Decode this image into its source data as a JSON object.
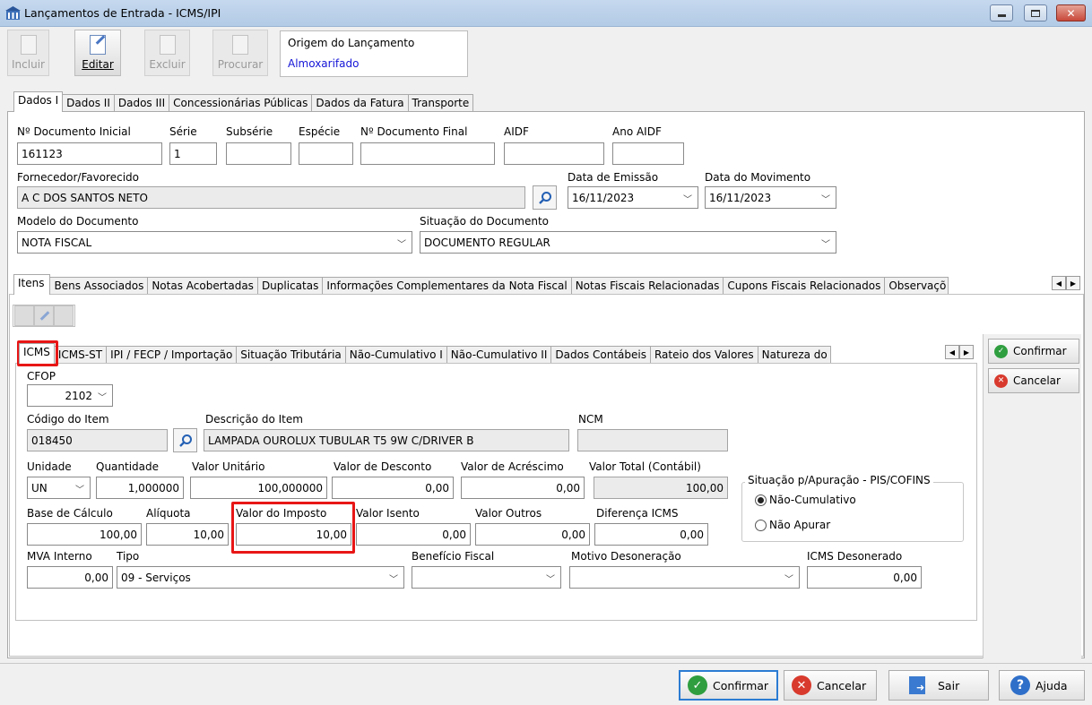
{
  "window": {
    "title": "Lançamentos de Entrada - ICMS/IPI"
  },
  "toolbar": {
    "incluir": "Incluir",
    "editar": "Editar",
    "excluir": "Excluir",
    "procurar": "Procurar"
  },
  "origem": {
    "label": "Origem do Lançamento",
    "value": "Almoxarifado"
  },
  "top_tabs": [
    "Dados I",
    "Dados II",
    "Dados III",
    "Concessionárias Públicas",
    "Dados da Fatura",
    "Transporte"
  ],
  "dados1": {
    "num_doc_inicial": {
      "label": "Nº Documento Inicial",
      "value": "161123"
    },
    "serie": {
      "label": "Série",
      "value": "1"
    },
    "subserie": {
      "label": "Subsérie",
      "value": ""
    },
    "especie": {
      "label": "Espécie",
      "value": ""
    },
    "num_doc_final": {
      "label": "Nº Documento Final",
      "value": ""
    },
    "aidf": {
      "label": "AIDF",
      "value": ""
    },
    "ano_aidf": {
      "label": "Ano AIDF",
      "value": ""
    },
    "fornecedor": {
      "label": "Fornecedor/Favorecido",
      "value": "A C DOS SANTOS NETO"
    },
    "data_emissao": {
      "label": "Data de Emissão",
      "value": "16/11/2023"
    },
    "data_movimento": {
      "label": "Data do Movimento",
      "value": "16/11/2023"
    },
    "modelo": {
      "label": "Modelo do Documento",
      "value": "NOTA FISCAL"
    },
    "situacao": {
      "label": "Situação do Documento",
      "value": "DOCUMENTO REGULAR"
    }
  },
  "mid_tabs": [
    "Itens",
    "Bens Associados",
    "Notas Acobertadas",
    "Duplicatas",
    "Informações Complementares da Nota Fiscal",
    "Notas Fiscais Relacionadas",
    "Cupons Fiscais Relacionados",
    "Observaçõ"
  ],
  "item_tabs": [
    "ICMS",
    "ICMS-ST",
    "IPI / FECP / Importação",
    "Situação Tributária",
    "Não-Cumulativo I",
    "Não-Cumulativo II",
    "Dados Contábeis",
    "Rateio dos Valores",
    "Natureza do"
  ],
  "icms": {
    "cfop": {
      "label": "CFOP",
      "value": "2102"
    },
    "codigo_item": {
      "label": "Código do Item",
      "value": "018450"
    },
    "descricao_item": {
      "label": "Descrição do Item",
      "value": "LAMPADA OUROLUX TUBULAR T5 9W C/DRIVER B"
    },
    "ncm": {
      "label": "NCM",
      "value": ""
    },
    "unidade": {
      "label": "Unidade",
      "value": "UN"
    },
    "quantidade": {
      "label": "Quantidade",
      "value": "1,000000"
    },
    "valor_unitario": {
      "label": "Valor Unitário",
      "value": "100,000000"
    },
    "valor_desconto": {
      "label": "Valor de Desconto",
      "value": "0,00"
    },
    "valor_acrescimo": {
      "label": "Valor de Acréscimo",
      "value": "0,00"
    },
    "valor_total": {
      "label": "Valor Total (Contábil)",
      "value": "100,00"
    },
    "base_calculo": {
      "label": "Base de Cálculo",
      "value": "100,00"
    },
    "aliquota": {
      "label": "Alíquota",
      "value": "10,00"
    },
    "valor_imposto": {
      "label": "Valor do Imposto",
      "value": "10,00"
    },
    "valor_isento": {
      "label": "Valor Isento",
      "value": "0,00"
    },
    "valor_outros": {
      "label": "Valor Outros",
      "value": "0,00"
    },
    "diferenca_icms": {
      "label": "Diferença ICMS",
      "value": "0,00"
    },
    "mva_interno": {
      "label": "MVA Interno",
      "value": "0,00"
    },
    "tipo": {
      "label": "Tipo",
      "value": "09 - Serviços"
    },
    "beneficio_fiscal": {
      "label": "Benefício Fiscal",
      "value": ""
    },
    "motivo_desoneracao": {
      "label": "Motivo Desoneração",
      "value": ""
    },
    "icms_desonerado": {
      "label": "ICMS Desonerado",
      "value": "0,00"
    },
    "apuracao": {
      "title": "Situação p/Apuração - PIS/COFINS",
      "opt1": "Não-Cumulativo",
      "opt2": "Não Apurar",
      "selected": "Não-Cumulativo"
    }
  },
  "side": {
    "confirmar": "Confirmar",
    "cancelar": "Cancelar"
  },
  "bottom": {
    "confirmar": "Confirmar",
    "cancelar": "Cancelar",
    "sair": "Sair",
    "ajuda": "Ajuda"
  }
}
